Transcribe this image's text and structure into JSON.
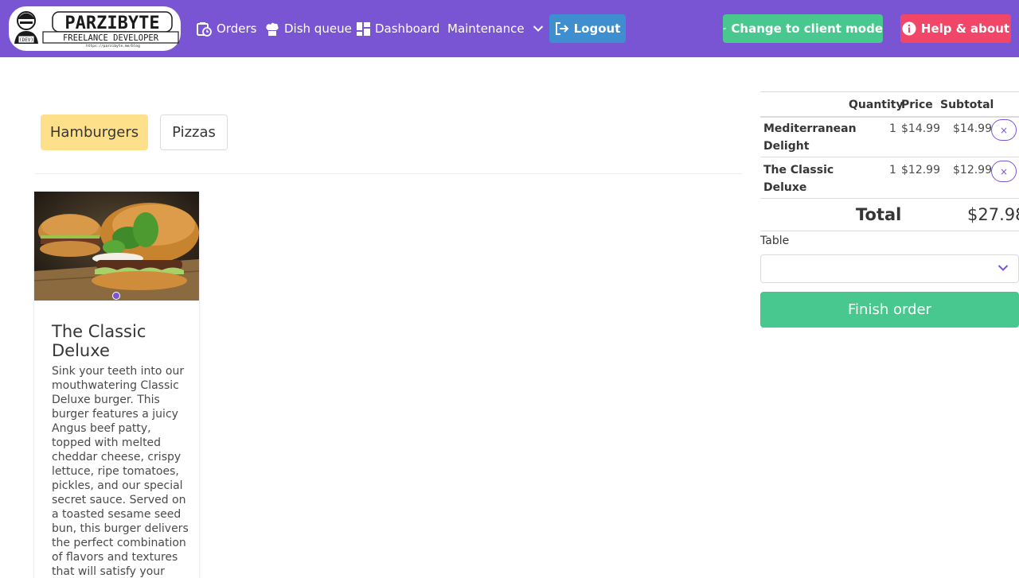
{
  "navbar": {
    "brand": {
      "title": "PARZIBYTE",
      "subtitle": "FREELANCE DEVELOPER",
      "url": "https://parzibyte.me/blog",
      "badge": "(DEV)"
    },
    "links": {
      "orders": "Orders",
      "dish_queue": "Dish queue",
      "dashboard": "Dashboard",
      "maintenance": "Maintenance"
    },
    "logout": "Logout",
    "client_mode": "Change to client mode",
    "help": "Help & about"
  },
  "categories": [
    "Hamburgers",
    "Pizzas"
  ],
  "product": {
    "name": "The Classic Deluxe",
    "description": "Sink your teeth into our mouthwatering Classic Deluxe burger. This burger features a juicy Angus beef patty, topped with melted cheddar cheese, crispy lettuce, ripe tomatoes, pickles, and our special secret sauce. Served on a toasted sesame seed bun, this burger delivers the perfect combination of flavors and textures that will satisfy your"
  },
  "order": {
    "headers": {
      "quantity": "Quantity",
      "price": "Price",
      "subtotal": "Subtotal"
    },
    "items": [
      {
        "name": "Mediterranean Delight",
        "quantity": "1",
        "price": "$14.99",
        "subtotal": "$14.99",
        "remove": "×"
      },
      {
        "name": "The Classic Deluxe",
        "quantity": "1",
        "price": "$12.99",
        "subtotal": "$12.99",
        "remove": "×"
      }
    ],
    "total_label": "Total",
    "total_value": "$27.98",
    "table_label": "Table",
    "table_value": "",
    "finish": "Finish order"
  },
  "colors": {
    "navbar": "#7a55d3",
    "logout": "#3e8ed0",
    "client_mode": "#48c78e",
    "help": "#f14668",
    "active_category": "#ffe08a"
  }
}
